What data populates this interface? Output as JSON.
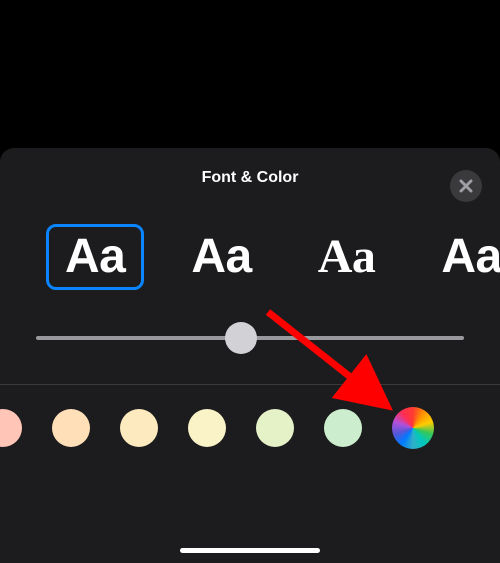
{
  "panel": {
    "title": "Font & Color",
    "closeIcon": "xmark"
  },
  "fonts": {
    "sample": "Aa",
    "options": [
      {
        "id": "sans",
        "sample": "Aa",
        "selected": true
      },
      {
        "id": "round",
        "sample": "Aa",
        "selected": false
      },
      {
        "id": "serif",
        "sample": "Aa",
        "selected": false
      },
      {
        "id": "alt",
        "sample": "Aa",
        "selected": false
      }
    ]
  },
  "slider": {
    "min": 0,
    "max": 1,
    "value": 0.48
  },
  "colors": {
    "swatches": [
      "#ffc6b8",
      "#ffdfb8",
      "#fdebbf",
      "#f9f3c7",
      "#e5f2c8",
      "#cceecf"
    ]
  },
  "annotation": {
    "arrowColor": "#ff0000"
  }
}
